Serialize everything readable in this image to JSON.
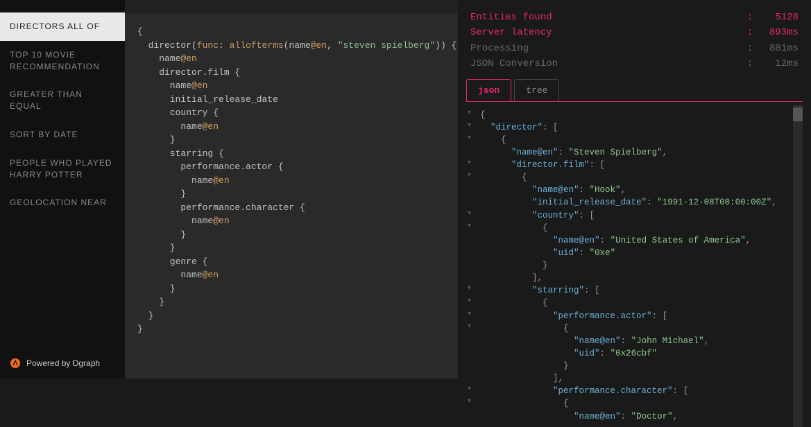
{
  "sidebar": {
    "items": [
      {
        "label": "DIRECTORS ALL OF",
        "active": true
      },
      {
        "label": "TOP 10 MOVIE RECOMMENDATION",
        "active": false
      },
      {
        "label": "GREATER THAN EQUAL",
        "active": false
      },
      {
        "label": "SORT BY DATE",
        "active": false
      },
      {
        "label": "PEOPLE WHO PLAYED HARRY POTTER",
        "active": false
      },
      {
        "label": "GEOLOCATION NEAR",
        "active": false
      }
    ],
    "footer": "Powered by Dgraph"
  },
  "editor": {
    "query": "{\n  director(func: allofterms(name@en, \"steven spielberg\")) {\n    name@en\n    director.film {\n      name@en\n      initial_release_date\n      country {\n        name@en\n      }\n      starring {\n        performance.actor {\n          name@en\n        }\n        performance.character {\n          name@en\n        }\n      }\n      genre {\n        name@en\n      }\n    }\n  }\n}"
  },
  "stats": {
    "entities_label": "Entities found",
    "entities_value": "5128",
    "latency_label": "Server latency",
    "latency_value": "893ms",
    "processing_label": "Processing",
    "processing_value": "881ms",
    "json_label": "JSON Conversion",
    "json_value": "12ms"
  },
  "tabs": {
    "json": "json",
    "tree": "tree"
  },
  "result_json": {
    "director": [
      {
        "name@en": "Steven Spielberg",
        "director.film": [
          {
            "name@en": "Hook",
            "initial_release_date": "1991-12-08T00:00:00Z",
            "country": [
              {
                "name@en": "United States of America",
                "uid": "0xe"
              }
            ],
            "starring": [
              {
                "performance.actor": [
                  {
                    "name@en": "John Michael",
                    "uid": "0x26cbf"
                  }
                ],
                "performance.character": [
                  {
                    "name@en": "Doctor"
                  }
                ]
              }
            ]
          }
        ]
      }
    ]
  },
  "json_lines": [
    {
      "indent": 0,
      "toggle": "-",
      "content": [
        {
          "t": "p",
          "v": "{"
        }
      ]
    },
    {
      "indent": 1,
      "toggle": "-",
      "content": [
        {
          "t": "k",
          "v": "\"director\""
        },
        {
          "t": "p",
          "v": ": ["
        }
      ]
    },
    {
      "indent": 2,
      "toggle": "-",
      "content": [
        {
          "t": "p",
          "v": "{"
        }
      ]
    },
    {
      "indent": 3,
      "toggle": "",
      "content": [
        {
          "t": "k",
          "v": "\"name@en\""
        },
        {
          "t": "p",
          "v": ": "
        },
        {
          "t": "s",
          "v": "\"Steven Spielberg\""
        },
        {
          "t": "p",
          "v": ","
        }
      ]
    },
    {
      "indent": 3,
      "toggle": "-",
      "content": [
        {
          "t": "k",
          "v": "\"director.film\""
        },
        {
          "t": "p",
          "v": ": ["
        }
      ]
    },
    {
      "indent": 4,
      "toggle": "-",
      "content": [
        {
          "t": "p",
          "v": "{"
        }
      ]
    },
    {
      "indent": 5,
      "toggle": "",
      "content": [
        {
          "t": "k",
          "v": "\"name@en\""
        },
        {
          "t": "p",
          "v": ": "
        },
        {
          "t": "s",
          "v": "\"Hook\""
        },
        {
          "t": "p",
          "v": ","
        }
      ]
    },
    {
      "indent": 5,
      "toggle": "",
      "content": [
        {
          "t": "k",
          "v": "\"initial_release_date\""
        },
        {
          "t": "p",
          "v": ": "
        },
        {
          "t": "s",
          "v": "\"1991-12-08T00:00:00Z\""
        },
        {
          "t": "p",
          "v": ","
        }
      ]
    },
    {
      "indent": 5,
      "toggle": "-",
      "content": [
        {
          "t": "k",
          "v": "\"country\""
        },
        {
          "t": "p",
          "v": ": ["
        }
      ]
    },
    {
      "indent": 6,
      "toggle": "-",
      "content": [
        {
          "t": "p",
          "v": "{"
        }
      ]
    },
    {
      "indent": 7,
      "toggle": "",
      "content": [
        {
          "t": "k",
          "v": "\"name@en\""
        },
        {
          "t": "p",
          "v": ": "
        },
        {
          "t": "s",
          "v": "\"United States of America\""
        },
        {
          "t": "p",
          "v": ","
        }
      ]
    },
    {
      "indent": 7,
      "toggle": "",
      "content": [
        {
          "t": "k",
          "v": "\"uid\""
        },
        {
          "t": "p",
          "v": ": "
        },
        {
          "t": "s",
          "v": "\"0xe\""
        }
      ]
    },
    {
      "indent": 6,
      "toggle": "",
      "content": [
        {
          "t": "p",
          "v": "}"
        }
      ]
    },
    {
      "indent": 5,
      "toggle": "",
      "content": [
        {
          "t": "p",
          "v": "],"
        }
      ]
    },
    {
      "indent": 5,
      "toggle": "-",
      "content": [
        {
          "t": "k",
          "v": "\"starring\""
        },
        {
          "t": "p",
          "v": ": ["
        }
      ]
    },
    {
      "indent": 6,
      "toggle": "-",
      "content": [
        {
          "t": "p",
          "v": "{"
        }
      ]
    },
    {
      "indent": 7,
      "toggle": "-",
      "content": [
        {
          "t": "k",
          "v": "\"performance.actor\""
        },
        {
          "t": "p",
          "v": ": ["
        }
      ]
    },
    {
      "indent": 8,
      "toggle": "-",
      "content": [
        {
          "t": "p",
          "v": "{"
        }
      ]
    },
    {
      "indent": 9,
      "toggle": "",
      "content": [
        {
          "t": "k",
          "v": "\"name@en\""
        },
        {
          "t": "p",
          "v": ": "
        },
        {
          "t": "s",
          "v": "\"John Michael\""
        },
        {
          "t": "p",
          "v": ","
        }
      ]
    },
    {
      "indent": 9,
      "toggle": "",
      "content": [
        {
          "t": "k",
          "v": "\"uid\""
        },
        {
          "t": "p",
          "v": ": "
        },
        {
          "t": "s",
          "v": "\"0x26cbf\""
        }
      ]
    },
    {
      "indent": 8,
      "toggle": "",
      "content": [
        {
          "t": "p",
          "v": "}"
        }
      ]
    },
    {
      "indent": 7,
      "toggle": "",
      "content": [
        {
          "t": "p",
          "v": "],"
        }
      ]
    },
    {
      "indent": 7,
      "toggle": "-",
      "content": [
        {
          "t": "k",
          "v": "\"performance.character\""
        },
        {
          "t": "p",
          "v": ": ["
        }
      ]
    },
    {
      "indent": 8,
      "toggle": "-",
      "content": [
        {
          "t": "p",
          "v": "{"
        }
      ]
    },
    {
      "indent": 9,
      "toggle": "",
      "content": [
        {
          "t": "k",
          "v": "\"name@en\""
        },
        {
          "t": "p",
          "v": ": "
        },
        {
          "t": "s",
          "v": "\"Doctor\""
        },
        {
          "t": "p",
          "v": ","
        }
      ]
    }
  ]
}
